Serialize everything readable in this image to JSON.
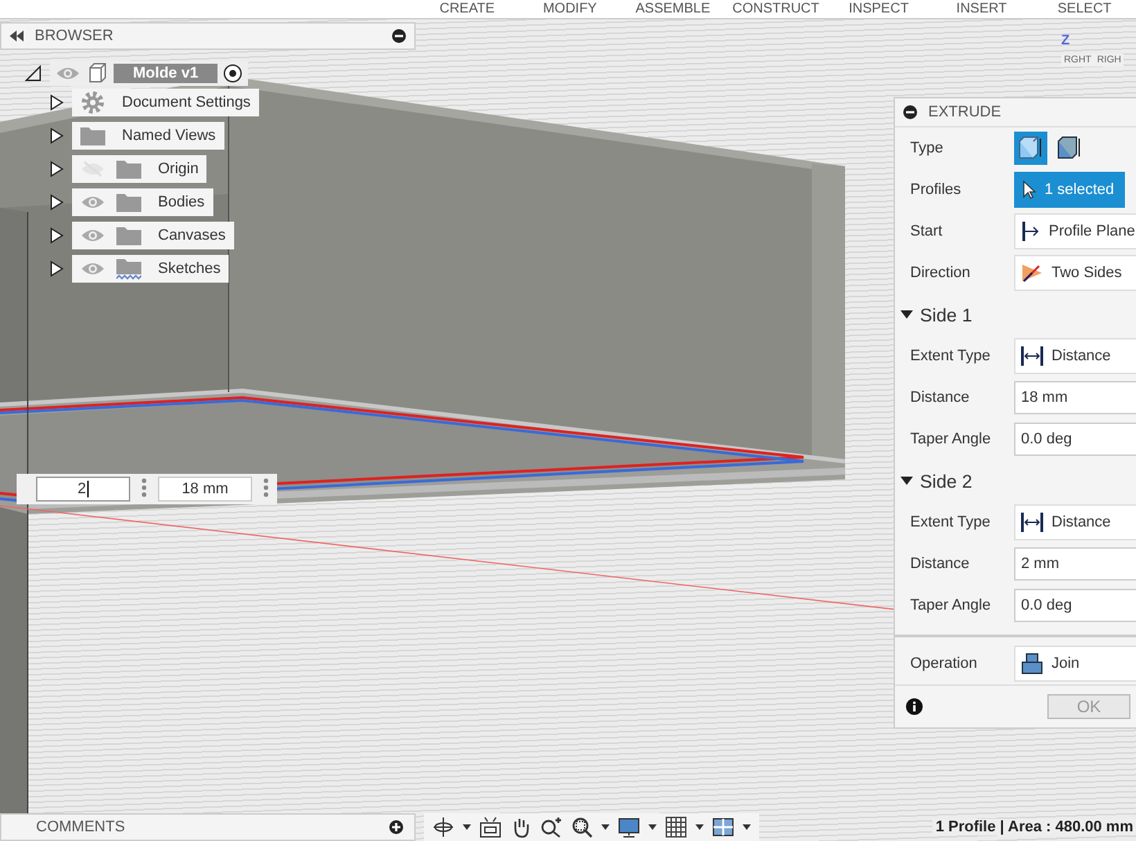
{
  "toolbar": {
    "menus": [
      {
        "label": "CREATE"
      },
      {
        "label": "MODIFY"
      },
      {
        "label": "ASSEMBLE"
      },
      {
        "label": "CONSTRUCT"
      },
      {
        "label": "INSPECT"
      },
      {
        "label": "INSERT"
      },
      {
        "label": "SELECT"
      }
    ]
  },
  "view_cube": {
    "axis": "Z",
    "faces": [
      "RGHT",
      "RIGH"
    ]
  },
  "browser": {
    "title": "BROWSER",
    "root": {
      "label": "Molde v1",
      "expanded": true,
      "children": [
        {
          "kind": "settings",
          "label": "Document Settings",
          "expanded": false
        },
        {
          "kind": "views",
          "label": "Named Views",
          "expanded": false
        },
        {
          "kind": "folder",
          "label": "Origin",
          "visible": false,
          "expanded": false
        },
        {
          "kind": "folder",
          "label": "Bodies",
          "visible": true,
          "expanded": false
        },
        {
          "kind": "folder",
          "label": "Canvases",
          "visible": true,
          "expanded": false
        },
        {
          "kind": "sketches",
          "label": "Sketches",
          "visible": true,
          "expanded": false
        }
      ]
    }
  },
  "dimension_inputs": [
    {
      "value": "2",
      "focused": true
    },
    {
      "value": "18 mm",
      "focused": false
    }
  ],
  "extrude": {
    "title": "EXTRUDE",
    "rows": [
      {
        "kind": "type",
        "label": "Type",
        "options": [
          {
            "selected": true
          },
          {
            "selected": false
          }
        ]
      },
      {
        "kind": "select",
        "label": "Profiles",
        "value": "1 selected",
        "active": true
      },
      {
        "kind": "start",
        "label": "Start",
        "value": "Profile Plane"
      },
      {
        "kind": "direction",
        "label": "Direction",
        "value": "Two Sides"
      },
      {
        "kind": "section",
        "label": "Side 1",
        "expanded": true
      },
      {
        "kind": "extent",
        "label": "Extent Type",
        "value": "Distance"
      },
      {
        "kind": "input",
        "label": "Distance",
        "value": "18 mm"
      },
      {
        "kind": "input",
        "label": "Taper Angle",
        "value": "0.0 deg"
      },
      {
        "kind": "section",
        "label": "Side 2",
        "expanded": true
      },
      {
        "kind": "extent",
        "label": "Extent Type",
        "value": "Distance"
      },
      {
        "kind": "input",
        "label": "Distance",
        "value": "2 mm"
      },
      {
        "kind": "input",
        "label": "Taper Angle",
        "value": "0.0 deg"
      },
      {
        "kind": "operation",
        "label": "Operation",
        "value": "Join"
      }
    ],
    "ok_button": {
      "label": "OK",
      "disabled": true
    }
  },
  "comments": {
    "title": "COMMENTS"
  },
  "status_bar": {
    "text": "1 Profile | Area : 480.00 mm"
  }
}
